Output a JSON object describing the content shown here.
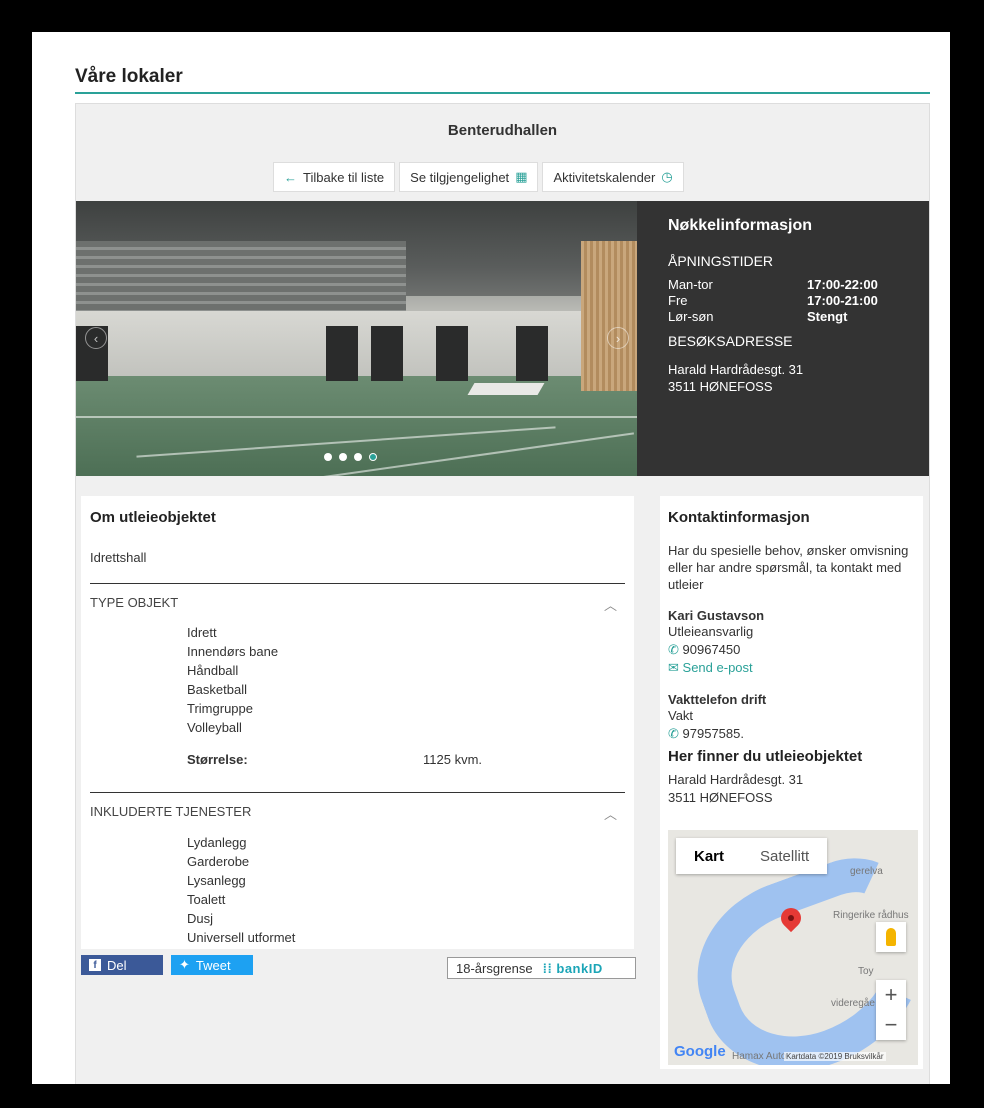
{
  "page": {
    "title": "Våre lokaler"
  },
  "venue": {
    "name": "Benterudhallen",
    "buttons": {
      "back": "Tilbake til liste",
      "availability": "Se tilgjengelighet",
      "calendar": "Aktivitetskalender"
    }
  },
  "carousel": {
    "slide_count": 4,
    "active_slide": 4
  },
  "key_info": {
    "title": "Nøkkelinformasjon",
    "hours_title": "ÅPNINGSTIDER",
    "hours": [
      {
        "days": "Man-tor",
        "time": "17:00-22:00"
      },
      {
        "days": "Fre",
        "time": "17:00-21:00"
      },
      {
        "days": "Lør-søn",
        "time": "Stengt"
      }
    ],
    "address_title": "BESØKSADRESSE",
    "address_line1": "Harald Hardrådesgt. 31",
    "address_line2": "3511 HØNEFOSS"
  },
  "about": {
    "title": "Om utleieobjektet",
    "type": "Idrettshall",
    "type_section_title": "TYPE OBJEKT",
    "type_items": [
      "Idrett",
      "Innendørs bane",
      "Håndball",
      "Basketball",
      "Trimgruppe",
      "Volleyball"
    ],
    "size_label": "Størrelse:",
    "size_value": "1125 kvm.",
    "services_section_title": "INKLUDERTE TJENESTER",
    "services": [
      "Lydanlegg",
      "Garderobe",
      "Lysanlegg",
      "Toalett",
      "Dusj",
      "Universell utformet"
    ]
  },
  "social": {
    "share": "Del",
    "tweet": "Tweet",
    "age_limit": "18-årsgrense",
    "bankid_logo": "bankID"
  },
  "contact": {
    "title": "Kontaktinformasjon",
    "intro": "Har du spesielle behov, ønsker omvisning eller har andre spørsmål, ta kontakt med utleier",
    "person_name": "Kari Gustavson",
    "person_role": "Utleieansvarlig",
    "person_phone": "90967450",
    "email_link": "Send e-post",
    "duty_title": "Vakttelefon drift",
    "duty_role": "Vakt",
    "duty_phone": "97957585.",
    "location_title": "Her finner du utleieobjektet",
    "location_line1": "Harald Hardrådesgt. 31",
    "location_line2": "3511 HØNEFOSS"
  },
  "map": {
    "tab_map": "Kart",
    "tab_satellite": "Satellitt",
    "label_river": "gerelva",
    "label_townhall": "Ringerike rådhus",
    "label_school": "videregåe",
    "label_tou": "Toy",
    "label_hamax": "Hamax Auto",
    "attribution": "Kartdata ©2019  Bruksvilkår",
    "logo": "Google",
    "zoom_in": "+",
    "zoom_out": "−"
  },
  "icons": {
    "back": "arrow-left-icon",
    "availability": "calendar-icon",
    "calendar": "clock-icon",
    "phone": "phone-icon",
    "email": "envelope-icon",
    "chevron": "chevron-up-icon"
  },
  "colors": {
    "accent": "#2aa198",
    "info_panel": "#333333",
    "facebook": "#3b5998",
    "twitter": "#1da1f2"
  }
}
